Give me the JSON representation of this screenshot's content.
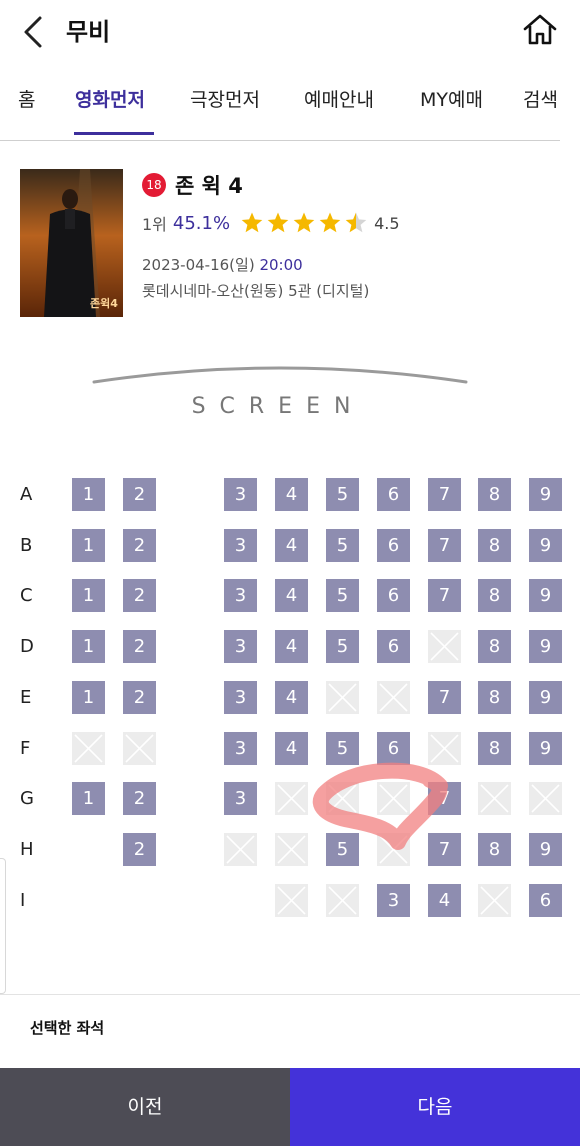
{
  "header": {
    "title": "무비",
    "back_icon": "chevron-left-icon",
    "home_icon": "home-icon"
  },
  "nav": {
    "tabs": [
      {
        "label": "홈",
        "active": false
      },
      {
        "label": "영화먼저",
        "active": true
      },
      {
        "label": "극장먼저",
        "active": false
      },
      {
        "label": "예매안내",
        "active": false
      },
      {
        "label": "MY예매",
        "active": false
      },
      {
        "label": "검색",
        "active": false
      }
    ]
  },
  "movie": {
    "age_rating": "18",
    "title": "존 윅 4",
    "rank": "1위",
    "booking_rate": "45.1%",
    "rating": 4.5,
    "rating_text": "4.5",
    "date": "2023-04-16(일)",
    "time": "20:00",
    "theater": "롯데시네마-오산(원동) 5관 (디지털)",
    "poster_text": "존윅4"
  },
  "screen": {
    "label": "SCREEN"
  },
  "seatmap": {
    "rows": [
      {
        "label": "A",
        "seats": [
          "1",
          "2",
          null,
          "3",
          "4",
          "5",
          "6",
          "7",
          "8",
          "9"
        ]
      },
      {
        "label": "B",
        "seats": [
          "1",
          "2",
          null,
          "3",
          "4",
          "5",
          "6",
          "7",
          "8",
          "9"
        ]
      },
      {
        "label": "C",
        "seats": [
          "1",
          "2",
          null,
          "3",
          "4",
          "5",
          "6",
          "7",
          "8",
          "9"
        ]
      },
      {
        "label": "D",
        "seats": [
          "1",
          "2",
          null,
          "3",
          "4",
          "5",
          "6",
          "x",
          "8",
          "9"
        ]
      },
      {
        "label": "E",
        "seats": [
          "1",
          "2",
          null,
          "3",
          "4",
          "x",
          "x",
          "7",
          "8",
          "9"
        ]
      },
      {
        "label": "F",
        "seats": [
          "x",
          "x",
          null,
          "3",
          "4",
          "5",
          "6",
          "x",
          "8",
          "9"
        ]
      },
      {
        "label": "G",
        "seats": [
          "1",
          "2",
          null,
          "3",
          "x",
          "x",
          "x",
          "7",
          "x",
          "x"
        ]
      },
      {
        "label": "H",
        "seats": [
          null,
          "2",
          null,
          "x",
          "x",
          "5",
          "x",
          "7",
          "8",
          "9"
        ]
      },
      {
        "label": "I",
        "seats": [
          null,
          null,
          null,
          null,
          "x",
          "x",
          "3",
          "4",
          "x",
          "6"
        ]
      }
    ]
  },
  "selection": {
    "label": "선택한 좌석"
  },
  "footer": {
    "prev_label": "이전",
    "next_label": "다음"
  },
  "colors": {
    "accent": "#3d2f9c",
    "seat_available": "#8e8db0",
    "seat_unavailable": "#ececec",
    "next_button": "#4432d9",
    "prev_button": "#4d4c55",
    "age_badge": "#e31b34",
    "star": "#f5b800"
  }
}
